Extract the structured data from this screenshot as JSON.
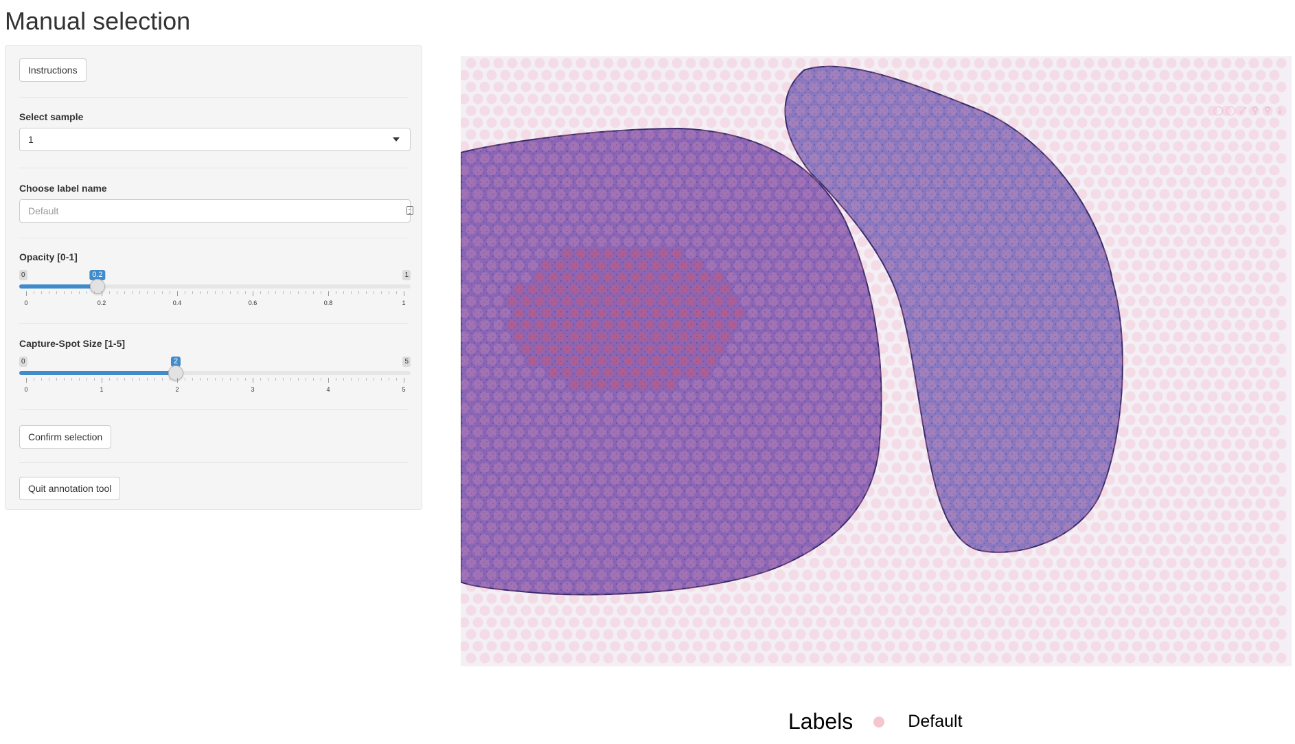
{
  "page": {
    "title": "Manual selection"
  },
  "sidebar": {
    "instructions_label": "Instructions",
    "sample": {
      "label": "Select sample",
      "selected": "1"
    },
    "label_name": {
      "label": "Choose label name",
      "placeholder": "Default"
    },
    "opacity": {
      "label": "Opacity [0-1]",
      "min": "0",
      "max": "1",
      "value": 0.2,
      "value_label": "0.2",
      "ticks": [
        "0",
        "0.2",
        "0.4",
        "0.6",
        "0.8",
        "1"
      ]
    },
    "spot_size": {
      "label": "Capture-Spot Size [1-5]",
      "min": "0",
      "max": "5",
      "value": 2,
      "value_label": "2",
      "ticks": [
        "0",
        "1",
        "2",
        "3",
        "4",
        "5"
      ]
    },
    "confirm_label": "Confirm selection",
    "quit_label": "Quit annotation tool"
  },
  "viewer": {
    "colors": {
      "tissue": "#8b66b6",
      "spot": "#f0a0b0",
      "selected_spot": "#c25a80"
    }
  },
  "legend": {
    "title": "Labels",
    "item": "Default",
    "color": "#f4c6cd"
  }
}
